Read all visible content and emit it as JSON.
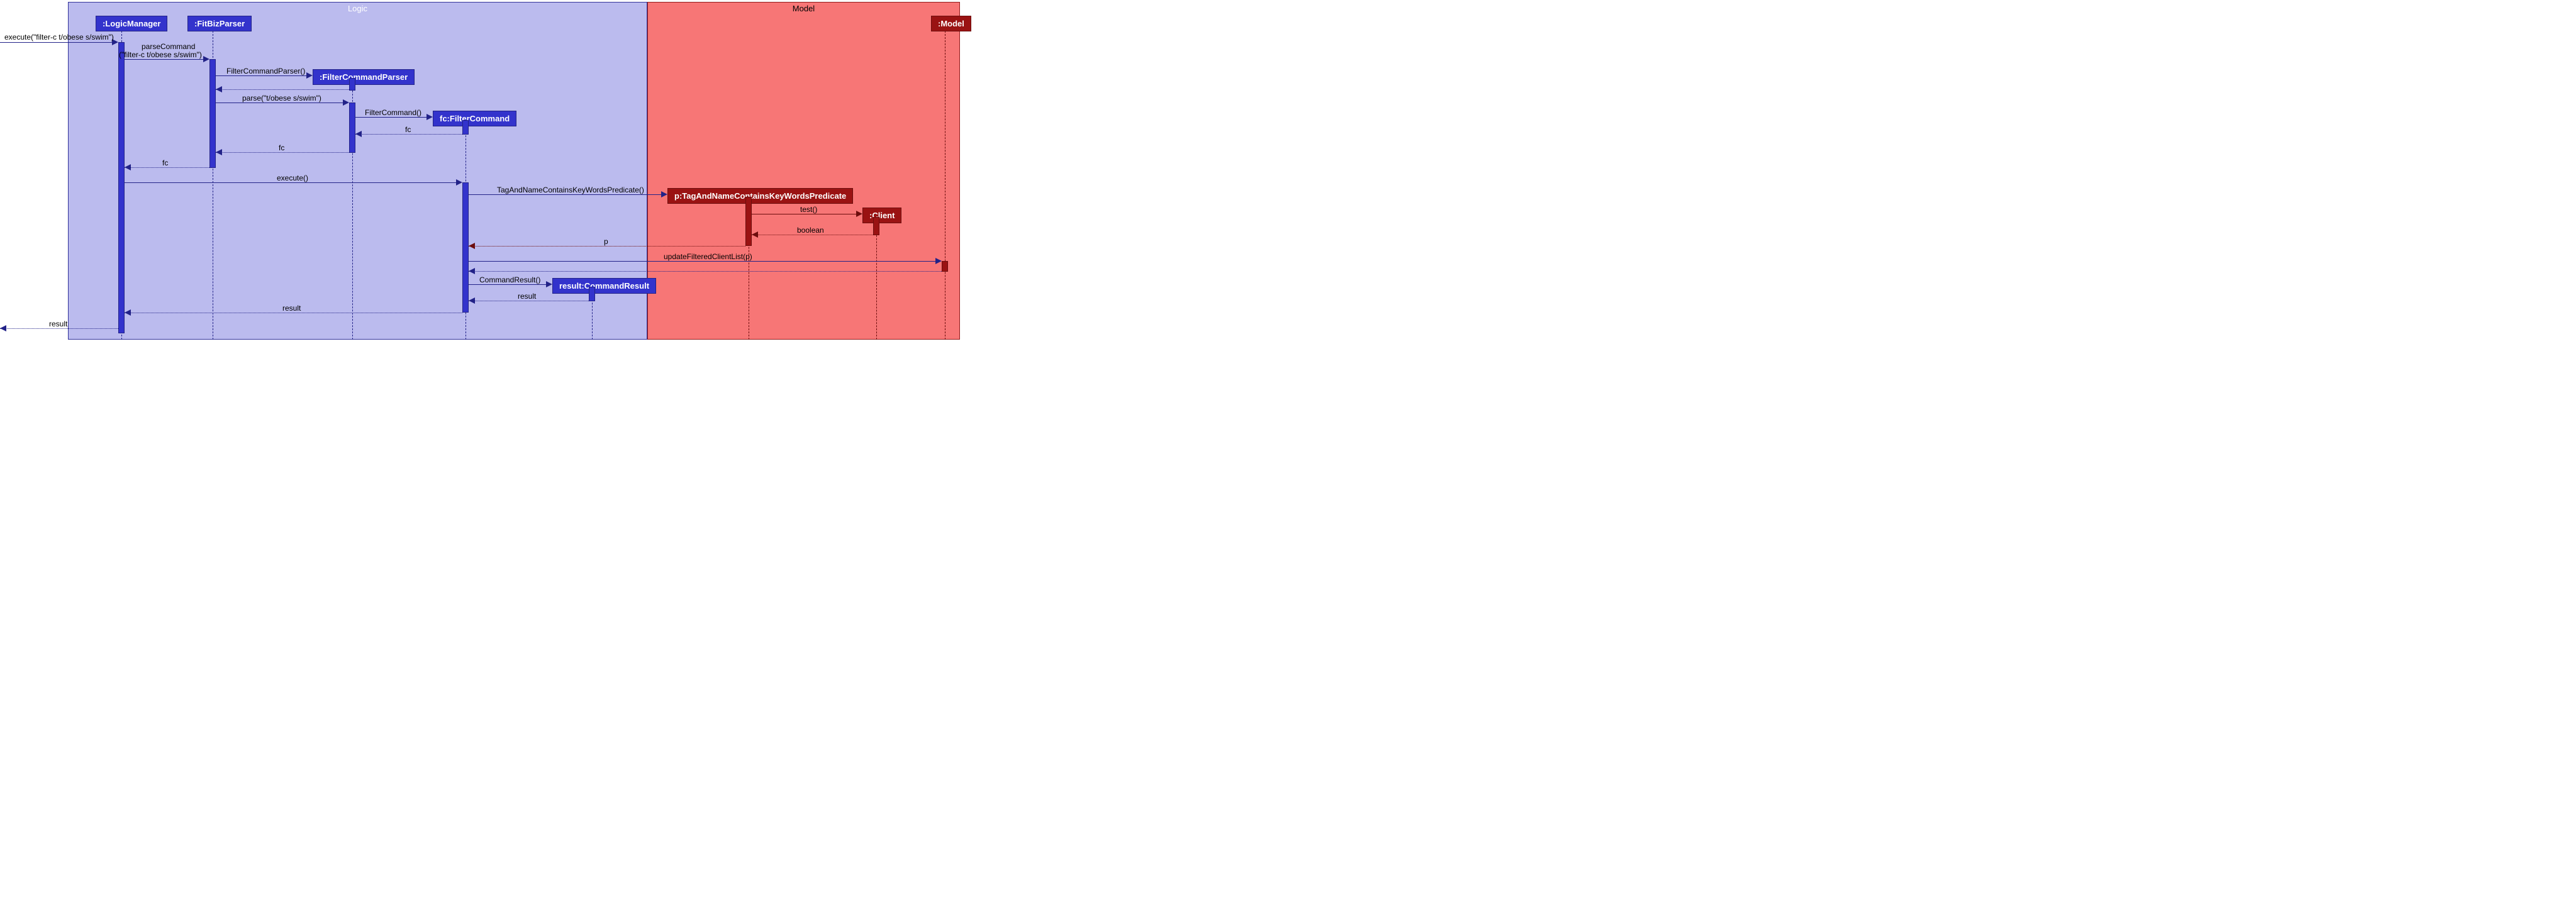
{
  "frames": {
    "logic": "Logic",
    "model": "Model"
  },
  "participants": {
    "logicManager": ":LogicManager",
    "fitBizParser": ":FitBizParser",
    "filterCommandParser": ":FilterCommandParser",
    "filterCommand": "fc:FilterCommand",
    "predicate": "p:TagAndNameContainsKeyWordsPredicate",
    "client": ":Client",
    "commandResult": "result:CommandResult",
    "modelObj": ":Model"
  },
  "messages": {
    "execute_in": "execute(\"filter-c t/obese s/swim\")",
    "parseCommand1": "parseCommand",
    "parseCommand2": "(\"filter-c t/obese s/swim\")",
    "newFCP": "FilterCommandParser()",
    "parse": "parse(\"t/obese s/swim\")",
    "newFC": "FilterCommand()",
    "ret_fc1": "fc",
    "ret_fc2": "fc",
    "ret_fc3": "fc",
    "execute2": "execute()",
    "newPred": "TagAndNameContainsKeyWordsPredicate()",
    "test": "test()",
    "ret_bool": "boolean",
    "ret_p": "p",
    "updateList": "updateFilteredClientList(p)",
    "newCR": "CommandResult()",
    "ret_result1": "result",
    "ret_result2": "result",
    "ret_result3": "result"
  },
  "chart_data": {
    "type": "sequence_diagram",
    "frames": [
      {
        "name": "Logic",
        "participants": [
          "LogicManager",
          "FitBizParser",
          "FilterCommandParser",
          "fc:FilterCommand",
          "result:CommandResult"
        ]
      },
      {
        "name": "Model",
        "participants": [
          "p:TagAndNameContainsKeyWordsPredicate",
          "Client",
          "Model"
        ]
      }
    ],
    "interactions": [
      {
        "from": "external",
        "to": "LogicManager",
        "label": "execute(\"filter-c t/obese s/swim\")",
        "type": "sync"
      },
      {
        "from": "LogicManager",
        "to": "FitBizParser",
        "label": "parseCommand(\"filter-c t/obese s/swim\")",
        "type": "sync"
      },
      {
        "from": "FitBizParser",
        "to": "FilterCommandParser",
        "label": "FilterCommandParser()",
        "type": "create"
      },
      {
        "from": "FilterCommandParser",
        "to": "FitBizParser",
        "label": "",
        "type": "return"
      },
      {
        "from": "FitBizParser",
        "to": "FilterCommandParser",
        "label": "parse(\"t/obese s/swim\")",
        "type": "sync"
      },
      {
        "from": "FilterCommandParser",
        "to": "fc:FilterCommand",
        "label": "FilterCommand()",
        "type": "create"
      },
      {
        "from": "fc:FilterCommand",
        "to": "FilterCommandParser",
        "label": "fc",
        "type": "return"
      },
      {
        "from": "FilterCommandParser",
        "to": "FitBizParser",
        "label": "fc",
        "type": "return"
      },
      {
        "from": "FitBizParser",
        "to": "LogicManager",
        "label": "fc",
        "type": "return"
      },
      {
        "from": "LogicManager",
        "to": "fc:FilterCommand",
        "label": "execute()",
        "type": "sync"
      },
      {
        "from": "fc:FilterCommand",
        "to": "p:TagAndNameContainsKeyWordsPredicate",
        "label": "TagAndNameContainsKeyWordsPredicate()",
        "type": "create"
      },
      {
        "from": "p:TagAndNameContainsKeyWordsPredicate",
        "to": "Client",
        "label": "test()",
        "type": "sync"
      },
      {
        "from": "Client",
        "to": "p:TagAndNameContainsKeyWordsPredicate",
        "label": "boolean",
        "type": "return"
      },
      {
        "from": "p:TagAndNameContainsKeyWordsPredicate",
        "to": "fc:FilterCommand",
        "label": "p",
        "type": "return"
      },
      {
        "from": "fc:FilterCommand",
        "to": "Model",
        "label": "updateFilteredClientList(p)",
        "type": "sync"
      },
      {
        "from": "Model",
        "to": "fc:FilterCommand",
        "label": "",
        "type": "return"
      },
      {
        "from": "fc:FilterCommand",
        "to": "result:CommandResult",
        "label": "CommandResult()",
        "type": "create"
      },
      {
        "from": "result:CommandResult",
        "to": "fc:FilterCommand",
        "label": "result",
        "type": "return"
      },
      {
        "from": "fc:FilterCommand",
        "to": "LogicManager",
        "label": "result",
        "type": "return"
      },
      {
        "from": "LogicManager",
        "to": "external",
        "label": "result",
        "type": "return"
      }
    ]
  }
}
